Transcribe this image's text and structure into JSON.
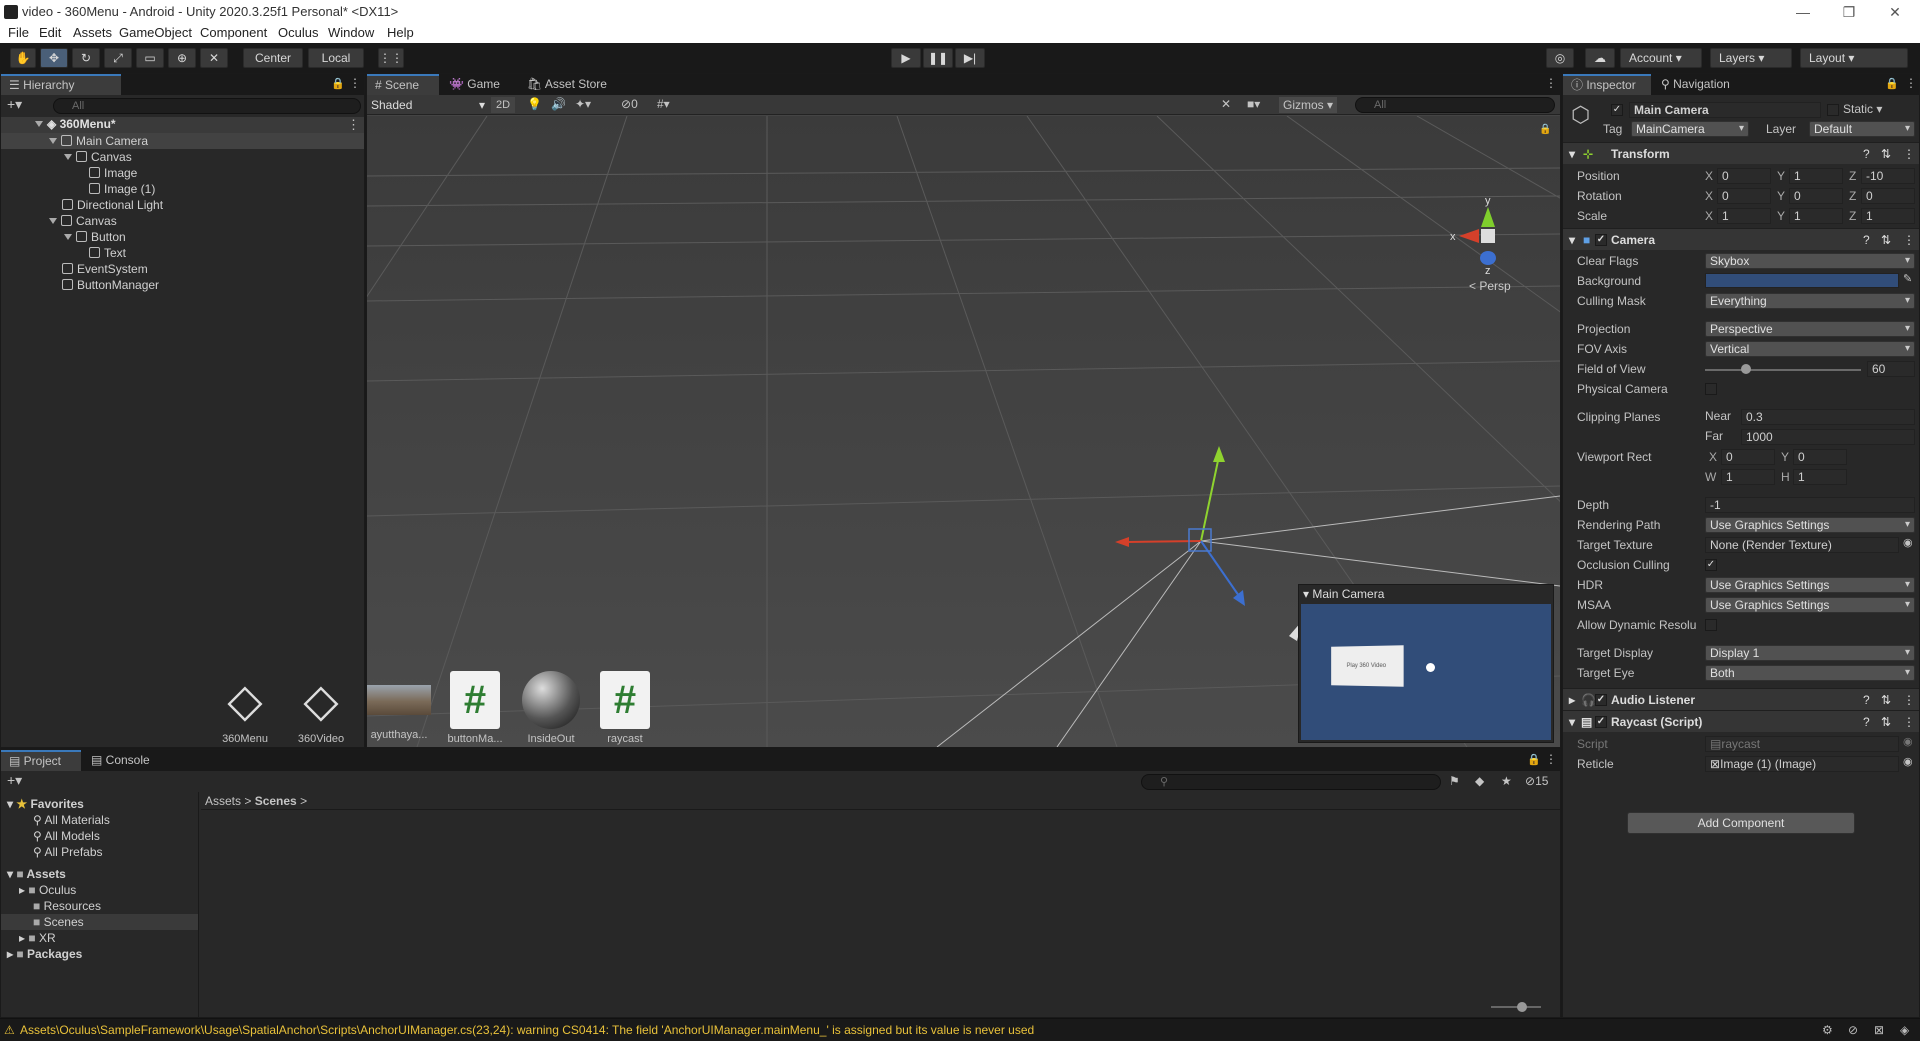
{
  "window": {
    "title": "video - 360Menu - Android - Unity 2020.3.25f1 Personal* <DX11>",
    "min": "—",
    "max": "❐",
    "close": "✕"
  },
  "menu": [
    "File",
    "Edit",
    "Assets",
    "GameObject",
    "Component",
    "Oculus",
    "Window",
    "Help"
  ],
  "toolbar": {
    "pivot_label": "Center",
    "space_label": "Local",
    "account_label": "Account",
    "layers_label": "Layers",
    "layout_label": "Layout"
  },
  "hierarchy": {
    "tab_label": "Hierarchy",
    "search_placeholder": "All",
    "scene_name": "360Menu*",
    "items": [
      {
        "label": "Main Camera",
        "depth": 1,
        "expanded": true
      },
      {
        "label": "Canvas",
        "depth": 2,
        "expanded": true
      },
      {
        "label": "Image",
        "depth": 3
      },
      {
        "label": "Image (1)",
        "depth": 3
      },
      {
        "label": "Directional Light",
        "depth": 1
      },
      {
        "label": "Canvas",
        "depth": 1,
        "expanded": true
      },
      {
        "label": "Button",
        "depth": 2,
        "expanded": true
      },
      {
        "label": "Text",
        "depth": 3
      },
      {
        "label": "EventSystem",
        "depth": 1
      },
      {
        "label": "ButtonManager",
        "depth": 1
      }
    ]
  },
  "scene": {
    "tabs": [
      "Scene",
      "Game",
      "Asset Store"
    ],
    "shading": "Shaded",
    "mode_2d": "2D",
    "hidden_count": "0",
    "gizmos_label": "Gizmos",
    "search_placeholder": "All",
    "persp_label": "< Persp",
    "axis_y": "y",
    "axis_x": "x",
    "axis_z": "z",
    "preview_title": "Main Camera",
    "preview_button_text": "Play 360 Video"
  },
  "inspector": {
    "tabs": [
      "Inspector",
      "Navigation"
    ],
    "object_name": "Main Camera",
    "static_label": "Static",
    "tag_label": "Tag",
    "tag_value": "MainCamera",
    "layer_label": "Layer",
    "layer_value": "Default",
    "transform": {
      "title": "Transform",
      "position_label": "Position",
      "position": [
        "0",
        "1",
        "-10"
      ],
      "rotation_label": "Rotation",
      "rotation": [
        "0",
        "0",
        "0"
      ],
      "scale_label": "Scale",
      "scale": [
        "1",
        "1",
        "1"
      ]
    },
    "camera": {
      "title": "Camera",
      "clear_flags_label": "Clear Flags",
      "clear_flags": "Skybox",
      "background_label": "Background",
      "background_color": "#314d79",
      "culling_mask_label": "Culling Mask",
      "culling_mask": "Everything",
      "projection_label": "Projection",
      "projection": "Perspective",
      "fov_axis_label": "FOV Axis",
      "fov_axis": "Vertical",
      "fov_label": "Field of View",
      "fov": "60",
      "fov_fraction": 0.26,
      "physical_label": "Physical Camera",
      "clipping_label": "Clipping Planes",
      "near_label": "Near",
      "near": "0.3",
      "far_label": "Far",
      "far": "1000",
      "viewport_label": "Viewport Rect",
      "vx": "0",
      "vy": "0",
      "vw": "1",
      "vh": "1",
      "depth_label": "Depth",
      "depth": "-1",
      "rendering_path_label": "Rendering Path",
      "rendering_path": "Use Graphics Settings",
      "target_texture_label": "Target Texture",
      "target_texture": "None (Render Texture)",
      "occlusion_label": "Occlusion Culling",
      "hdr_label": "HDR",
      "hdr": "Use Graphics Settings",
      "msaa_label": "MSAA",
      "msaa": "Use Graphics Settings",
      "dynamic_label": "Allow Dynamic Resolu",
      "target_display_label": "Target Display",
      "target_display": "Display 1",
      "target_eye_label": "Target Eye",
      "target_eye": "Both"
    },
    "audio_listener": {
      "title": "Audio Listener"
    },
    "raycast": {
      "title": "Raycast (Script)",
      "script_label": "Script",
      "script_value": "raycast",
      "reticle_label": "Reticle",
      "reticle_value": "Image (1) (Image)"
    },
    "add_component": "Add Component"
  },
  "project": {
    "tabs": [
      "Project",
      "Console"
    ],
    "hidden_count": "15",
    "favorites_label": "Favorites",
    "favorites": [
      "All Materials",
      "All Models",
      "All Prefabs"
    ],
    "assets_label": "Assets",
    "folders": [
      "Oculus",
      "Resources",
      "Scenes",
      "XR"
    ],
    "packages_label": "Packages",
    "breadcrumb": [
      "Assets",
      "Scenes"
    ],
    "files": [
      {
        "name": "360Menu",
        "kind": "unity"
      },
      {
        "name": "360Video",
        "kind": "unity"
      },
      {
        "name": "ayutthaya...",
        "kind": "image"
      },
      {
        "name": "buttonMa...",
        "kind": "script"
      },
      {
        "name": "InsideOut",
        "kind": "material"
      },
      {
        "name": "raycast",
        "kind": "script"
      }
    ]
  },
  "status": {
    "message": "Assets\\Oculus\\SampleFramework\\Usage\\SpatialAnchor\\Scripts\\AnchorUIManager.cs(23,24): warning CS0414: The field 'AnchorUIManager.mainMenu_' is assigned but its value is never used"
  }
}
